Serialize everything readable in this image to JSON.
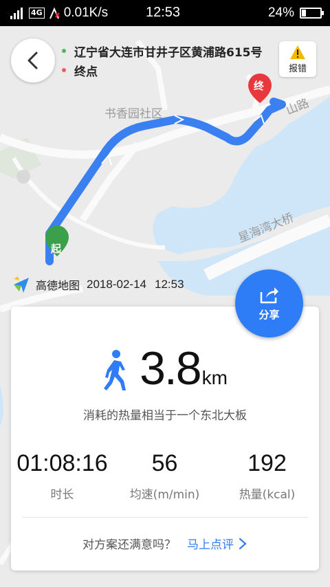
{
  "status_bar": {
    "network": "4G",
    "speed": "0.01K/s",
    "time": "12:53",
    "battery": "24%",
    "battery_level": 0.24
  },
  "map": {
    "labels": {
      "community": "书香园社区",
      "bridge": "星海湾大桥",
      "road_suffix": "山路"
    },
    "start_marker": "起",
    "end_marker": "终",
    "route_color": "#3a80f0"
  },
  "route": {
    "origin": "辽宁省大连市甘井子区黄浦路615号",
    "destination": "终点",
    "origin_dot_color": "#4cba54",
    "destination_dot_color": "#ee5b5b"
  },
  "report": {
    "label": "报错"
  },
  "watermark": {
    "brand": "高德地图",
    "date": "2018-02-14",
    "time": "12:53"
  },
  "share": {
    "label": "分享"
  },
  "summary": {
    "distance": "3.8",
    "unit": "km",
    "calorie_compare": "消耗的热量相当于一个东北大板"
  },
  "stats": [
    {
      "value": "01:08:16",
      "label": "时长"
    },
    {
      "value": "56",
      "label": "均速(m/min)"
    },
    {
      "value": "192",
      "label": "热量(kcal)"
    }
  ],
  "feedback": {
    "question": "对方案还满意吗？",
    "link": "马上点评"
  },
  "colors": {
    "accent": "#2f7df6",
    "water": "#cfe5f8"
  }
}
